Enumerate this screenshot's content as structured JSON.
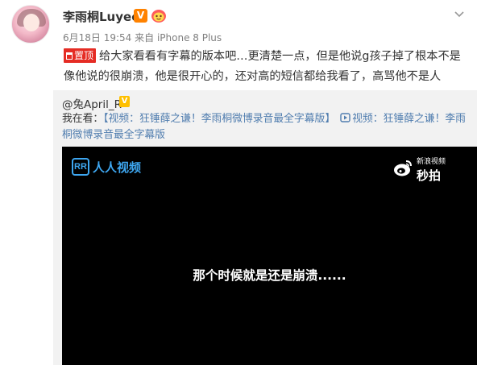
{
  "author": {
    "name": "李雨桐Luyee",
    "vip_mark": "V"
  },
  "meta": {
    "date": "6月18日 19:54",
    "source": "来自 iPhone 8 Plus"
  },
  "post": {
    "tag": "置顶",
    "text": "给大家看看有字幕的版本吧…更清楚一点，但是他说g孩子掉了根本不是像他说的很崩溃，他是很开心的，还对高的短信都给我看了，高骂他不是人"
  },
  "repost": {
    "user": "@兔April_R",
    "prefix": "我在看：",
    "link_text": "【视频：狂锤薛之谦！李雨桐微博录音最全字幕版】",
    "link_card": "视频：狂锤薛之谦！李雨桐微博录音最全字幕版"
  },
  "video": {
    "logo_mark": "RR",
    "logo_name": "人人视频",
    "watermark_top": "新浪视频",
    "watermark_bottom": "秒拍",
    "subtitle": "那个时候就是还是崩溃......"
  },
  "colors": {
    "link": "#507daf",
    "tag_bg": "#e52c24",
    "vip": "#ff8200",
    "repost_bg": "#f2f2f2",
    "rr_blue": "#3ea7f1"
  },
  "icons": [
    "vip-icon",
    "fan-badge-icon",
    "chevron-down-icon",
    "link-icon",
    "weibo-logo-icon"
  ]
}
